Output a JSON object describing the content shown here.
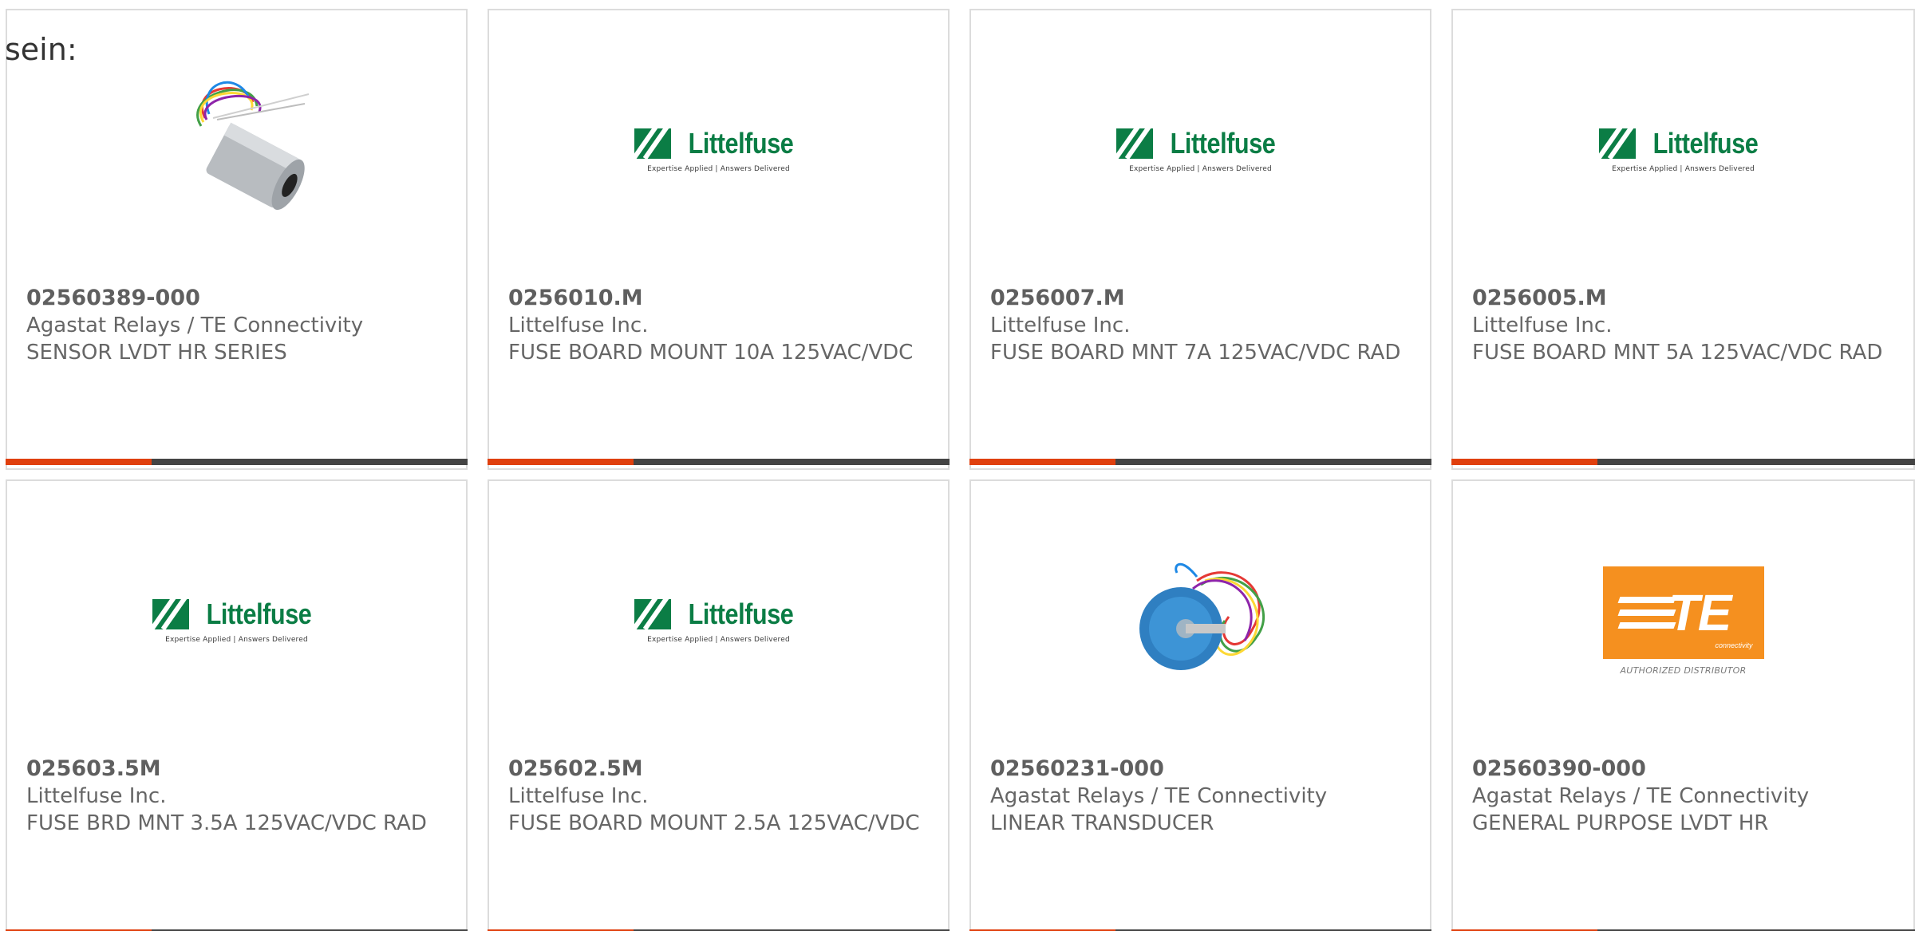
{
  "intro_text": "sein:",
  "products": [
    {
      "part_number": "02560389-000",
      "manufacturer": "Agastat Relays / TE Connectivity",
      "description": "SENSOR LVDT HR SERIES",
      "image_icon": "lvdt-sensor-cylinder-icon"
    },
    {
      "part_number": "0256010.M",
      "manufacturer": "Littelfuse Inc.",
      "description": "FUSE BOARD MOUNT 10A 125VAC/VDC",
      "image_icon": "littelfuse-logo"
    },
    {
      "part_number": "0256007.M",
      "manufacturer": "Littelfuse Inc.",
      "description": "FUSE BOARD MNT 7A 125VAC/VDC RAD",
      "image_icon": "littelfuse-logo"
    },
    {
      "part_number": "0256005.M",
      "manufacturer": "Littelfuse Inc.",
      "description": "FUSE BOARD MNT 5A 125VAC/VDC RAD",
      "image_icon": "littelfuse-logo"
    },
    {
      "part_number": "025603.5M",
      "manufacturer": "Littelfuse Inc.",
      "description": "FUSE BRD MNT 3.5A 125VAC/VDC RAD",
      "image_icon": "littelfuse-logo"
    },
    {
      "part_number": "025602.5M",
      "manufacturer": "Littelfuse Inc.",
      "description": "FUSE BOARD MOUNT 2.5A 125VAC/VDC",
      "image_icon": "littelfuse-logo"
    },
    {
      "part_number": "02560231-000",
      "manufacturer": "Agastat Relays / TE Connectivity",
      "description": "LINEAR TRANSDUCER",
      "image_icon": "linear-transducer-icon"
    },
    {
      "part_number": "02560390-000",
      "manufacturer": "Agastat Relays / TE Connectivity",
      "description": "GENERAL PURPOSE LVDT HR",
      "image_icon": "te-connectivity-logo"
    }
  ],
  "littelfuse_logo": {
    "wordmark": "Littelfuse",
    "tagline": "Expertise Applied | Answers Delivered"
  },
  "te_logo": {
    "letters": "TE",
    "sub": "connectivity",
    "distributor": "AUTHORIZED DISTRIBUTOR"
  },
  "colors": {
    "accent_orange": "#e0400e",
    "bar_dark": "#444444",
    "littelfuse_green": "#0b7d45",
    "te_orange": "#f5901f",
    "card_border": "#dcdcdc",
    "text_gray": "#666666"
  }
}
